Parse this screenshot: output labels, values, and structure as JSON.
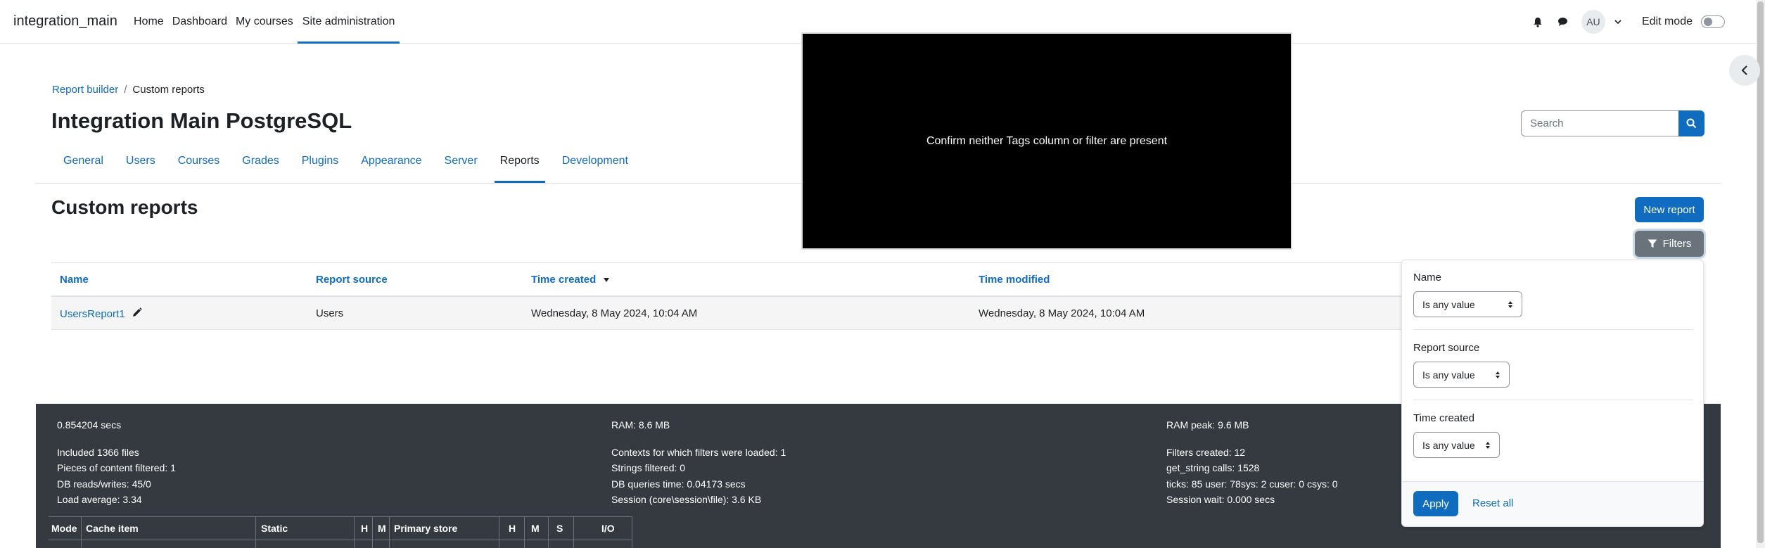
{
  "navbar": {
    "brand": "integration_main",
    "items": [
      {
        "label": "Home"
      },
      {
        "label": "Dashboard"
      },
      {
        "label": "My courses"
      },
      {
        "label": "Site administration"
      }
    ],
    "avatar_initials": "AU",
    "edit_mode_label": "Edit mode"
  },
  "breadcrumb": {
    "items": [
      {
        "label": "Report builder"
      },
      {
        "label": "Custom reports"
      }
    ]
  },
  "page_title": "Integration Main PostgreSQL",
  "search": {
    "placeholder": "Search"
  },
  "secondary_nav": {
    "tabs": [
      {
        "label": "General"
      },
      {
        "label": "Users"
      },
      {
        "label": "Courses"
      },
      {
        "label": "Grades"
      },
      {
        "label": "Plugins"
      },
      {
        "label": "Appearance"
      },
      {
        "label": "Server"
      },
      {
        "label": "Reports"
      },
      {
        "label": "Development"
      }
    ]
  },
  "section_title": "Custom reports",
  "buttons": {
    "new_report": "New report",
    "filters": "Filters"
  },
  "table": {
    "headers": [
      "Name",
      "Report source",
      "Time created",
      "Time modified"
    ],
    "rows": [
      {
        "name": "UsersReport1",
        "source": "Users",
        "created": "Wednesday, 8 May 2024, 10:04 AM",
        "modified": "Wednesday, 8 May 2024, 10:04 AM"
      }
    ]
  },
  "overlay_text": "Confirm neither Tags column or filter are present",
  "filters": {
    "groups": [
      {
        "label": "Name",
        "value": "Is any value"
      },
      {
        "label": "Report source",
        "value": "Is any value"
      },
      {
        "label": "Time created",
        "value": "Is any value"
      }
    ],
    "apply": "Apply",
    "reset": "Reset all"
  },
  "perf": {
    "col1": [
      "0.854204 secs",
      "Included 1366 files",
      "Pieces of content filtered: 1",
      "DB reads/writes: 45/0",
      "Load average: 3.34"
    ],
    "col2": [
      "RAM: 8.6 MB",
      "Contexts for which filters were loaded: 1",
      "Strings filtered: 0",
      "DB queries time: 0.04173 secs",
      "Session (core\\session\\file): 3.6 KB"
    ],
    "col3": [
      "RAM peak: 9.6 MB",
      "Filters created: 12",
      "get_string calls: 1528",
      "ticks: 85 user: 78sys: 2 cuser: 0 csys: 0",
      "Session wait: 0.000 secs"
    ],
    "cache_headers": [
      "Mode",
      "Cache item",
      "Static",
      "H",
      "M",
      "Primary store",
      "H",
      "M",
      "S",
      "I/O"
    ]
  }
}
